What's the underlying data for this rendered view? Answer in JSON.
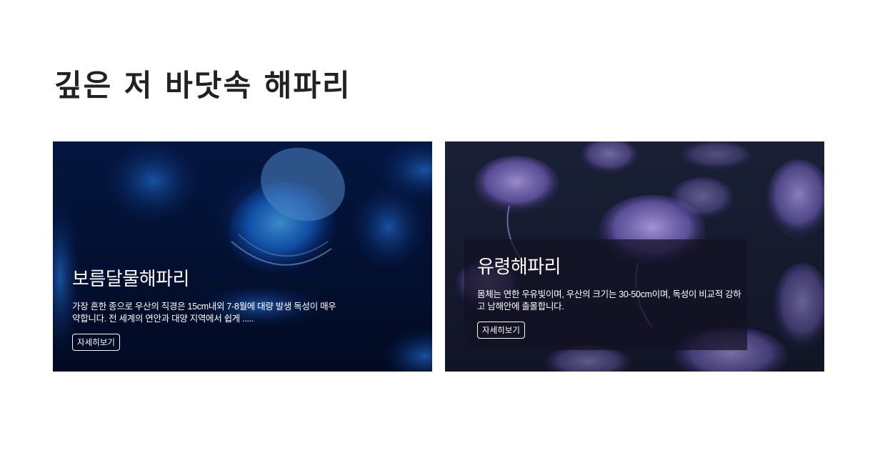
{
  "page": {
    "title": "깊은 저 바닷속 해파리"
  },
  "cards": [
    {
      "title": "보름달물해파리",
      "description": "가장 흔한 종으로 우산의 직경은 15cm내외 7-8월에 대량 발생 독성이 매우 약합니다. 전 세계의 연안과 대양 지역에서 쉽게 .....",
      "button_label": "자세히보기",
      "image": "blue-jellyfish-photo"
    },
    {
      "title": "유령해파리",
      "description": "몸체는 연한 우유빛이며, 우산의 크기는 30-50cm이며, 독성이 비교적 강하고 남해안에 출몰합니다.",
      "button_label": "자세히보기",
      "image": "purple-jellyfish-photo"
    }
  ],
  "colors": {
    "card1_bg": "#041233",
    "card2_bg": "#151a2e",
    "title": "#222222",
    "text": "#ffffff"
  }
}
